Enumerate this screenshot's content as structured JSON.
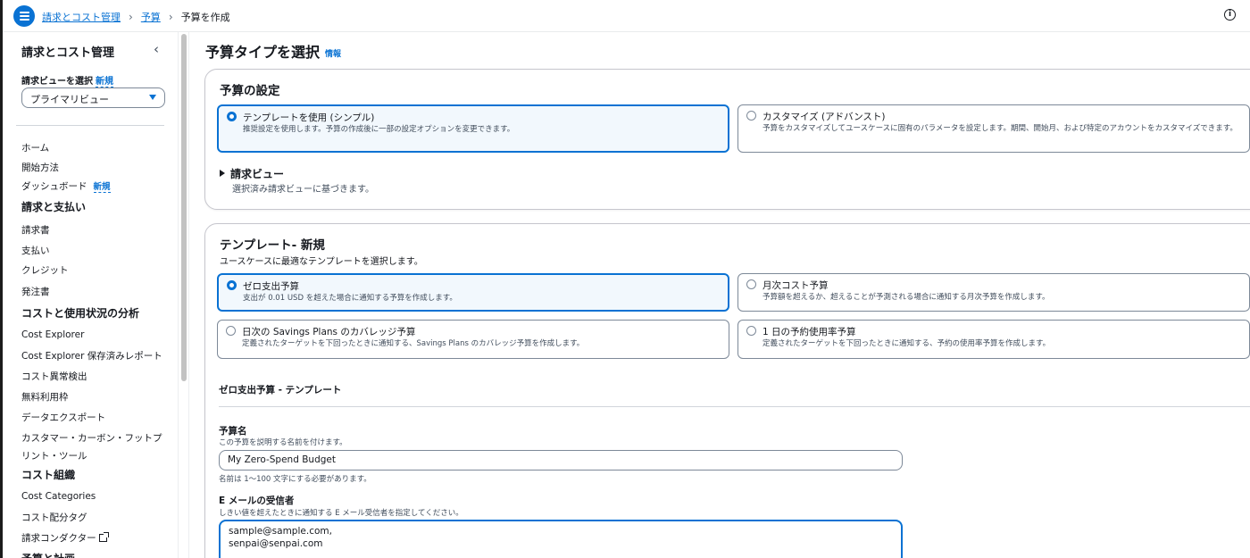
{
  "top_bar": {
    "menu_icon": "hamburger-menu-icon",
    "breadcrumbs": [
      "請求とコスト管理",
      "予算",
      "予算を作成"
    ],
    "info_icon": "info-circle-icon"
  },
  "sidebar": {
    "title": "請求とコスト管理",
    "billing_view_label": "請求ビューを選択",
    "new_badge": "新規",
    "billing_view_value": "プライマリビュー",
    "items": {
      "home": "ホーム",
      "getting_started": "開始方法",
      "dashboard": "ダッシュボード",
      "billing_heading": "請求と支払い",
      "bills": "請求書",
      "payments": "支払い",
      "credits": "クレジット",
      "purchase_orders": "発注書",
      "cost_analysis_heading": "コストと使用状況の分析",
      "cost_explorer": "Cost Explorer",
      "cost_explorer_saved": "Cost Explorer 保存済みレポート",
      "anomaly_detection": "コスト異常検出",
      "free_tier": "無料利用枠",
      "data_exports": "データエクスポート",
      "carbon_line1": "カスタマー・カーボン・フットプ",
      "carbon_line2": "リント・ツール",
      "cost_org_heading": "コスト組織",
      "cost_categories": "Cost Categories",
      "cost_allocation_tags": "コスト配分タグ",
      "billing_conductor": "請求コンダクター",
      "budgets_heading": "予算と計画"
    }
  },
  "main": {
    "page_title": "予算タイプを選択",
    "info_link": "情報",
    "setup_panel": {
      "title": "予算の設定",
      "template_option": {
        "label": "テンプレートを使用 (シンプル)",
        "desc": "推奨設定を使用します。予算の作成後に一部の設定オプションを変更できます。"
      },
      "custom_option": {
        "label": "カスタマイズ (アドバンスト)",
        "desc": "予算をカスタマイズしてユースケースに固有のパラメータを設定します。期間、開始月、および特定のアカウントをカスタマイズできます。"
      },
      "billing_view_expander": "請求ビュー",
      "billing_view_desc": "選択済み請求ビューに基づきます。"
    },
    "template_panel": {
      "title": "テンプレート- 新規",
      "desc": "ユースケースに最適なテンプレートを選択します。",
      "options": {
        "zero_spend": {
          "label": "ゼロ支出予算",
          "desc": "支出が 0.01 USD を超えた場合に通知する予算を作成します。"
        },
        "monthly_cost": {
          "label": "月次コスト予算",
          "desc": "予算額を超えるか、超えることが予測される場合に通知する月次予算を作成します。"
        },
        "savings_plans": {
          "label": "日次の Savings Plans のカバレッジ予算",
          "desc": "定義されたターゲットを下回ったときに通知する、Savings Plans のカバレッジ予算を作成します。"
        },
        "reservation_util": {
          "label": "1 日の予約使用率予算",
          "desc": "定義されたターゲットを下回ったときに通知する、予約の使用率予算を作成します。"
        }
      },
      "section_title": "ゼロ支出予算 - テンプレート",
      "budget_name": {
        "label": "予算名",
        "desc": "この予算を説明する名前を付けます。",
        "value": "My Zero-Spend Budget",
        "hint": "名前は 1〜100 文字にする必要があります。"
      },
      "email": {
        "label": "E メールの受信者",
        "desc": "しきい値を超えたときに通知する E メール受信者を指定してください。",
        "line1": "sample@sample.com,",
        "line2": "senpai@senpai.com"
      }
    }
  }
}
